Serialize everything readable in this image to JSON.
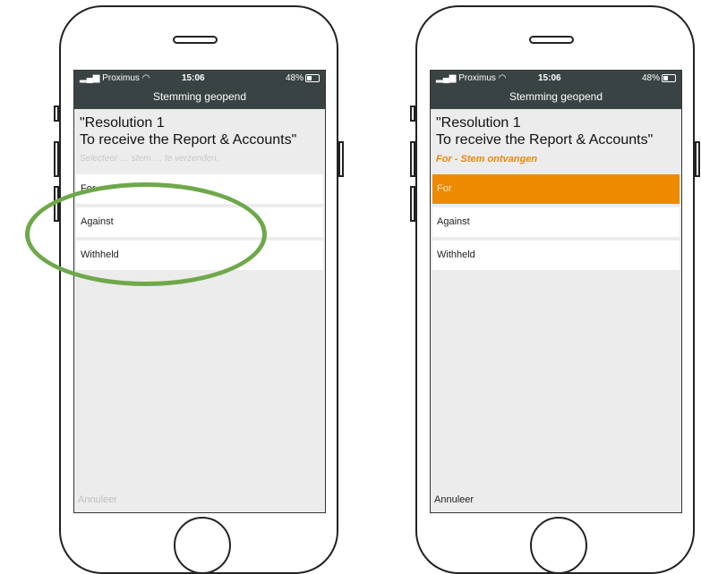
{
  "left_phone": {
    "status": {
      "carrier": "Proximus",
      "time": "15:06",
      "battery": "48%"
    },
    "nav_title": "Stemming geopend",
    "resolution": {
      "line1": "\"Resolution 1",
      "line2": "To receive the Report & Accounts\""
    },
    "hint": "Selecteer … stem … te verzenden.",
    "options": [
      {
        "label": "For"
      },
      {
        "label": "Against"
      },
      {
        "label": "Withheld"
      }
    ],
    "cancel": "Annuleer"
  },
  "right_phone": {
    "status": {
      "carrier": "Proximus",
      "time": "15:06",
      "battery": "48%"
    },
    "nav_title": "Stemming geopend",
    "resolution": {
      "line1": "\"Resolution 1",
      "line2": "To receive the Report & Accounts\""
    },
    "confirmation": "For - Stem ontvangen",
    "options": [
      {
        "label": "For",
        "selected": true
      },
      {
        "label": "Against"
      },
      {
        "label": "Withheld"
      }
    ],
    "cancel": "Annuleer"
  },
  "colors": {
    "header": "#3a4343",
    "accent": "#ee8a00",
    "confirmation": "#e8890c",
    "highlight": "#6fa84a"
  },
  "icons": [
    "signal-icon",
    "wifi-icon",
    "battery-icon"
  ]
}
